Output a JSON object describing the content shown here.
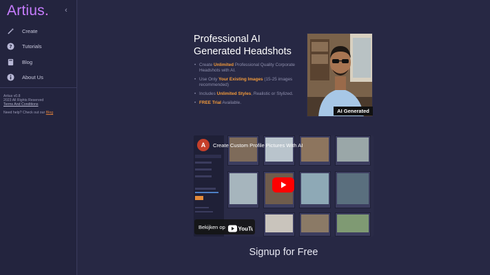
{
  "app": {
    "logo": "Artius",
    "logo_dot": "."
  },
  "sidebar": {
    "collapse_glyph": "‹",
    "items": [
      {
        "label": "Create",
        "icon": "magic-wand-icon"
      },
      {
        "label": "Tutorials",
        "icon": "help-circle-icon"
      },
      {
        "label": "Blog",
        "icon": "book-icon"
      },
      {
        "label": "About Us",
        "icon": "info-icon"
      }
    ],
    "footer": {
      "version": "Artius v0.8",
      "rights": "2023 All Rights Reserved",
      "terms": "Terms And Conditions",
      "help_prefix": "Need help? Check out our",
      "help_link": "Blog"
    }
  },
  "hero": {
    "title": "Professional AI Generated Headshots",
    "bullets": [
      {
        "pre": "Create ",
        "hl": "Unlimited",
        "post": " Professional Quality Corporate Headshots with AI."
      },
      {
        "pre": "Use Only ",
        "hl": "Your Existing Images",
        "post": " (15-25 images recommended)"
      },
      {
        "pre": "Includes ",
        "hl": "Unlimited Styles",
        "post": ", Realistic or Stylized."
      },
      {
        "pre": "",
        "hl": "FREE Trial",
        "post": " Available."
      }
    ],
    "badge": "AI Generated"
  },
  "video": {
    "channel_initial": "A",
    "title": "Create Custom Profile Pictures With AI",
    "watch_on": "Bekijken op",
    "platform": "YouTube"
  },
  "signup": {
    "label": "Signup for Free"
  },
  "colors": {
    "accent": "#c77dff",
    "highlight": "#f29a3b",
    "bg": "#272844",
    "sidebar": "#23243e"
  }
}
